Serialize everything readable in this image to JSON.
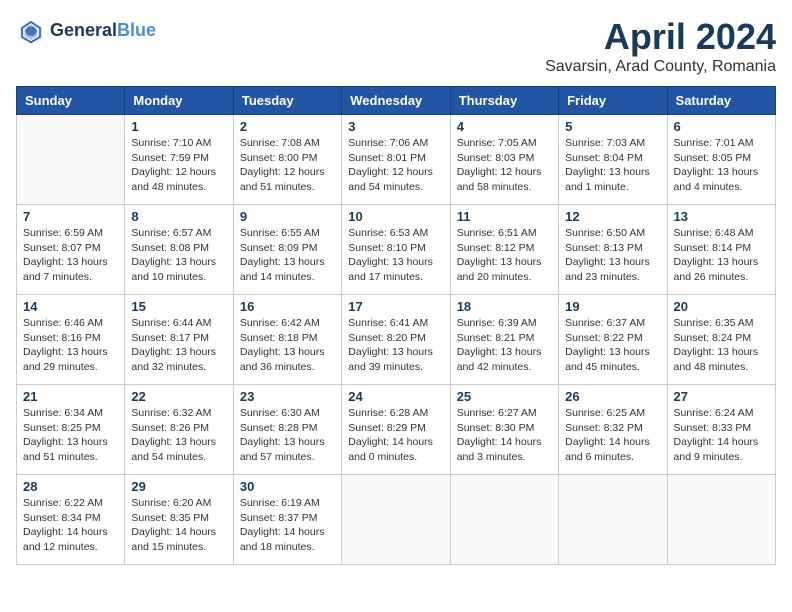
{
  "header": {
    "logo_line1": "General",
    "logo_line2": "Blue",
    "month": "April 2024",
    "location": "Savarsin, Arad County, Romania"
  },
  "weekdays": [
    "Sunday",
    "Monday",
    "Tuesday",
    "Wednesday",
    "Thursday",
    "Friday",
    "Saturday"
  ],
  "weeks": [
    [
      {
        "day": "",
        "info": ""
      },
      {
        "day": "1",
        "info": "Sunrise: 7:10 AM\nSunset: 7:59 PM\nDaylight: 12 hours\nand 48 minutes."
      },
      {
        "day": "2",
        "info": "Sunrise: 7:08 AM\nSunset: 8:00 PM\nDaylight: 12 hours\nand 51 minutes."
      },
      {
        "day": "3",
        "info": "Sunrise: 7:06 AM\nSunset: 8:01 PM\nDaylight: 12 hours\nand 54 minutes."
      },
      {
        "day": "4",
        "info": "Sunrise: 7:05 AM\nSunset: 8:03 PM\nDaylight: 12 hours\nand 58 minutes."
      },
      {
        "day": "5",
        "info": "Sunrise: 7:03 AM\nSunset: 8:04 PM\nDaylight: 13 hours\nand 1 minute."
      },
      {
        "day": "6",
        "info": "Sunrise: 7:01 AM\nSunset: 8:05 PM\nDaylight: 13 hours\nand 4 minutes."
      }
    ],
    [
      {
        "day": "7",
        "info": "Sunrise: 6:59 AM\nSunset: 8:07 PM\nDaylight: 13 hours\nand 7 minutes."
      },
      {
        "day": "8",
        "info": "Sunrise: 6:57 AM\nSunset: 8:08 PM\nDaylight: 13 hours\nand 10 minutes."
      },
      {
        "day": "9",
        "info": "Sunrise: 6:55 AM\nSunset: 8:09 PM\nDaylight: 13 hours\nand 14 minutes."
      },
      {
        "day": "10",
        "info": "Sunrise: 6:53 AM\nSunset: 8:10 PM\nDaylight: 13 hours\nand 17 minutes."
      },
      {
        "day": "11",
        "info": "Sunrise: 6:51 AM\nSunset: 8:12 PM\nDaylight: 13 hours\nand 20 minutes."
      },
      {
        "day": "12",
        "info": "Sunrise: 6:50 AM\nSunset: 8:13 PM\nDaylight: 13 hours\nand 23 minutes."
      },
      {
        "day": "13",
        "info": "Sunrise: 6:48 AM\nSunset: 8:14 PM\nDaylight: 13 hours\nand 26 minutes."
      }
    ],
    [
      {
        "day": "14",
        "info": "Sunrise: 6:46 AM\nSunset: 8:16 PM\nDaylight: 13 hours\nand 29 minutes."
      },
      {
        "day": "15",
        "info": "Sunrise: 6:44 AM\nSunset: 8:17 PM\nDaylight: 13 hours\nand 32 minutes."
      },
      {
        "day": "16",
        "info": "Sunrise: 6:42 AM\nSunset: 8:18 PM\nDaylight: 13 hours\nand 36 minutes."
      },
      {
        "day": "17",
        "info": "Sunrise: 6:41 AM\nSunset: 8:20 PM\nDaylight: 13 hours\nand 39 minutes."
      },
      {
        "day": "18",
        "info": "Sunrise: 6:39 AM\nSunset: 8:21 PM\nDaylight: 13 hours\nand 42 minutes."
      },
      {
        "day": "19",
        "info": "Sunrise: 6:37 AM\nSunset: 8:22 PM\nDaylight: 13 hours\nand 45 minutes."
      },
      {
        "day": "20",
        "info": "Sunrise: 6:35 AM\nSunset: 8:24 PM\nDaylight: 13 hours\nand 48 minutes."
      }
    ],
    [
      {
        "day": "21",
        "info": "Sunrise: 6:34 AM\nSunset: 8:25 PM\nDaylight: 13 hours\nand 51 minutes."
      },
      {
        "day": "22",
        "info": "Sunrise: 6:32 AM\nSunset: 8:26 PM\nDaylight: 13 hours\nand 54 minutes."
      },
      {
        "day": "23",
        "info": "Sunrise: 6:30 AM\nSunset: 8:28 PM\nDaylight: 13 hours\nand 57 minutes."
      },
      {
        "day": "24",
        "info": "Sunrise: 6:28 AM\nSunset: 8:29 PM\nDaylight: 14 hours\nand 0 minutes."
      },
      {
        "day": "25",
        "info": "Sunrise: 6:27 AM\nSunset: 8:30 PM\nDaylight: 14 hours\nand 3 minutes."
      },
      {
        "day": "26",
        "info": "Sunrise: 6:25 AM\nSunset: 8:32 PM\nDaylight: 14 hours\nand 6 minutes."
      },
      {
        "day": "27",
        "info": "Sunrise: 6:24 AM\nSunset: 8:33 PM\nDaylight: 14 hours\nand 9 minutes."
      }
    ],
    [
      {
        "day": "28",
        "info": "Sunrise: 6:22 AM\nSunset: 8:34 PM\nDaylight: 14 hours\nand 12 minutes."
      },
      {
        "day": "29",
        "info": "Sunrise: 6:20 AM\nSunset: 8:35 PM\nDaylight: 14 hours\nand 15 minutes."
      },
      {
        "day": "30",
        "info": "Sunrise: 6:19 AM\nSunset: 8:37 PM\nDaylight: 14 hours\nand 18 minutes."
      },
      {
        "day": "",
        "info": ""
      },
      {
        "day": "",
        "info": ""
      },
      {
        "day": "",
        "info": ""
      },
      {
        "day": "",
        "info": ""
      }
    ]
  ]
}
